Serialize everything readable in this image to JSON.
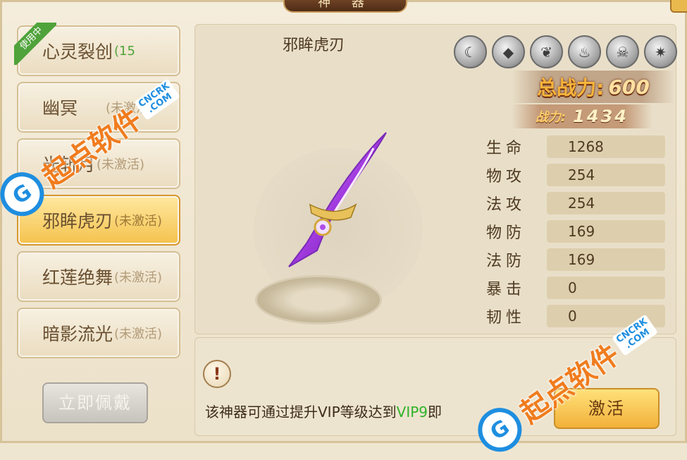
{
  "window": {
    "title": "神 器"
  },
  "weapon_list": [
    {
      "name": "心灵裂创",
      "status": "(15",
      "active": false,
      "in_use": true
    },
    {
      "name": "幽冥",
      "status": "(未激活)",
      "active": false,
      "in_use": false
    },
    {
      "name": "光斩月",
      "status": "(未激活)",
      "active": false,
      "in_use": false
    },
    {
      "name": "邪眸虎刃",
      "status": "(未激活)",
      "active": true,
      "in_use": false
    },
    {
      "name": "红莲绝舞",
      "status": "(未激活)",
      "active": false,
      "in_use": false
    },
    {
      "name": "暗影流光",
      "status": "(未激活)",
      "active": false,
      "in_use": false
    }
  ],
  "in_use_label": "使用中",
  "wear_button": "立即佩戴",
  "detail": {
    "weapon_name": "邪眸虎刃",
    "element_icons": [
      "moon-element-icon",
      "crystal-element-icon",
      "dragon-element-icon",
      "fire-element-icon",
      "demon-mask-element-icon",
      "beast-element-icon"
    ],
    "total_power_label": "总战力:",
    "total_power_value": "600",
    "power_label": "战力:",
    "power_value": "1434",
    "stats": [
      {
        "label": "生命",
        "value": "1268"
      },
      {
        "label": "物攻",
        "value": "254"
      },
      {
        "label": "法攻",
        "value": "254"
      },
      {
        "label": "物防",
        "value": "169"
      },
      {
        "label": "法防",
        "value": "169"
      },
      {
        "label": "暴击",
        "value": "0"
      },
      {
        "label": "韧性",
        "value": "0"
      }
    ]
  },
  "hint": {
    "prefix": "该神器可通过提升VIP等级达到",
    "vip": "VIP9",
    "suffix": "即"
  },
  "activate_button": "激活",
  "watermark": {
    "logo": "G",
    "text": "起点软件",
    "domain_top": "CNCRK",
    "domain_bottom": ".COM"
  }
}
